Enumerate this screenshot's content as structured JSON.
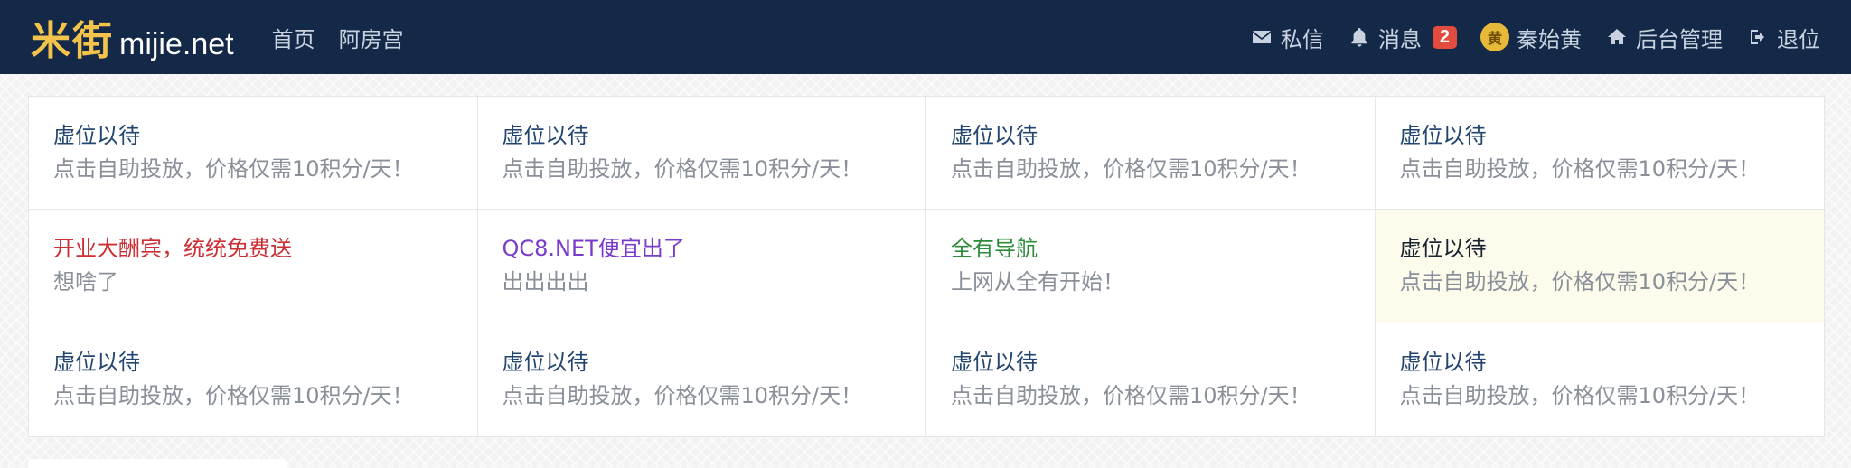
{
  "brand": {
    "name_cn": "米街",
    "name_en": "mijie.net",
    "color": "#f3c34b"
  },
  "nav": {
    "left": [
      "首页",
      "阿房宫"
    ]
  },
  "user_nav": {
    "messages_label": "私信",
    "notifications_label": "消息",
    "notifications_count": "2",
    "avatar_char": "黄",
    "username": "秦始黄",
    "admin_label": "后台管理",
    "logout_label": "退位"
  },
  "ads": [
    {
      "title": "虚位以待",
      "desc": "点击自助投放，价格仅需10积分/天！",
      "color": "#23466e"
    },
    {
      "title": "虚位以待",
      "desc": "点击自助投放，价格仅需10积分/天！",
      "color": "#23466e"
    },
    {
      "title": "虚位以待",
      "desc": "点击自助投放，价格仅需10积分/天！",
      "color": "#23466e"
    },
    {
      "title": "虚位以待",
      "desc": "点击自助投放，价格仅需10积分/天！",
      "color": "#23466e"
    },
    {
      "title": "开业大酬宾，统统免费送",
      "desc": "想啥了",
      "color": "#cc2e34"
    },
    {
      "title": "QC8.NET便宜出了",
      "desc": "出出出出",
      "color": "#7a3bcc"
    },
    {
      "title": "全有导航",
      "desc": "上网从全有开始！",
      "color": "#2e8b3a"
    },
    {
      "title": "虚位以待",
      "desc": "点击自助投放，价格仅需10积分/天！",
      "color": "#1a2430",
      "highlight": true
    },
    {
      "title": "虚位以待",
      "desc": "点击自助投放，价格仅需10积分/天！",
      "color": "#23466e"
    },
    {
      "title": "虚位以待",
      "desc": "点击自助投放，价格仅需10积分/天！",
      "color": "#23466e"
    },
    {
      "title": "虚位以待",
      "desc": "点击自助投放，价格仅需10积分/天！",
      "color": "#23466e"
    },
    {
      "title": "虚位以待",
      "desc": "点击自助投放，价格仅需10积分/天！",
      "color": "#23466e"
    }
  ],
  "colors": {
    "navbar_bg": "#132947",
    "badge": "#e24c3e"
  }
}
